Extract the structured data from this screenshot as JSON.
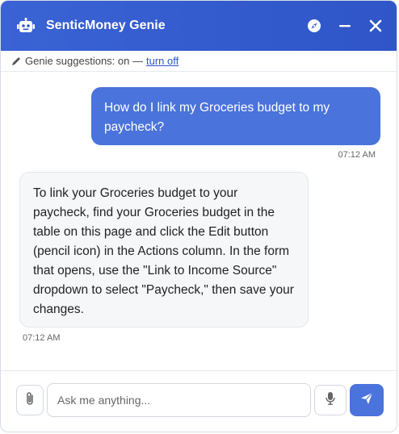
{
  "header": {
    "title": "SenticMoney Genie",
    "icons": [
      "robot-icon",
      "compass-icon",
      "minimize-icon",
      "close-icon"
    ]
  },
  "suggestions": {
    "text": "Genie suggestions: on —",
    "link": "turn off"
  },
  "messages": [
    {
      "role": "user",
      "text": "How do I link my Groceries budget to my paycheck?",
      "time": "07:12 AM"
    },
    {
      "role": "assistant",
      "text": "To link your Groceries budget to your paycheck, find your Groceries budget in the table on this page and click the Edit button (pencil icon) in the Actions column. In the form that opens, use the \"Link to Income Source\" dropdown to select \"Paycheck,\" then save your changes.",
      "time": "07:12 AM"
    }
  ],
  "composer": {
    "placeholder": "Ask me anything...",
    "value": ""
  },
  "colors": {
    "header": "#3a63d4",
    "user_bubble": "#4a73db",
    "send_button": "#4a73db",
    "bot_bubble": "#f6f7f9",
    "link": "#2f55c9"
  }
}
